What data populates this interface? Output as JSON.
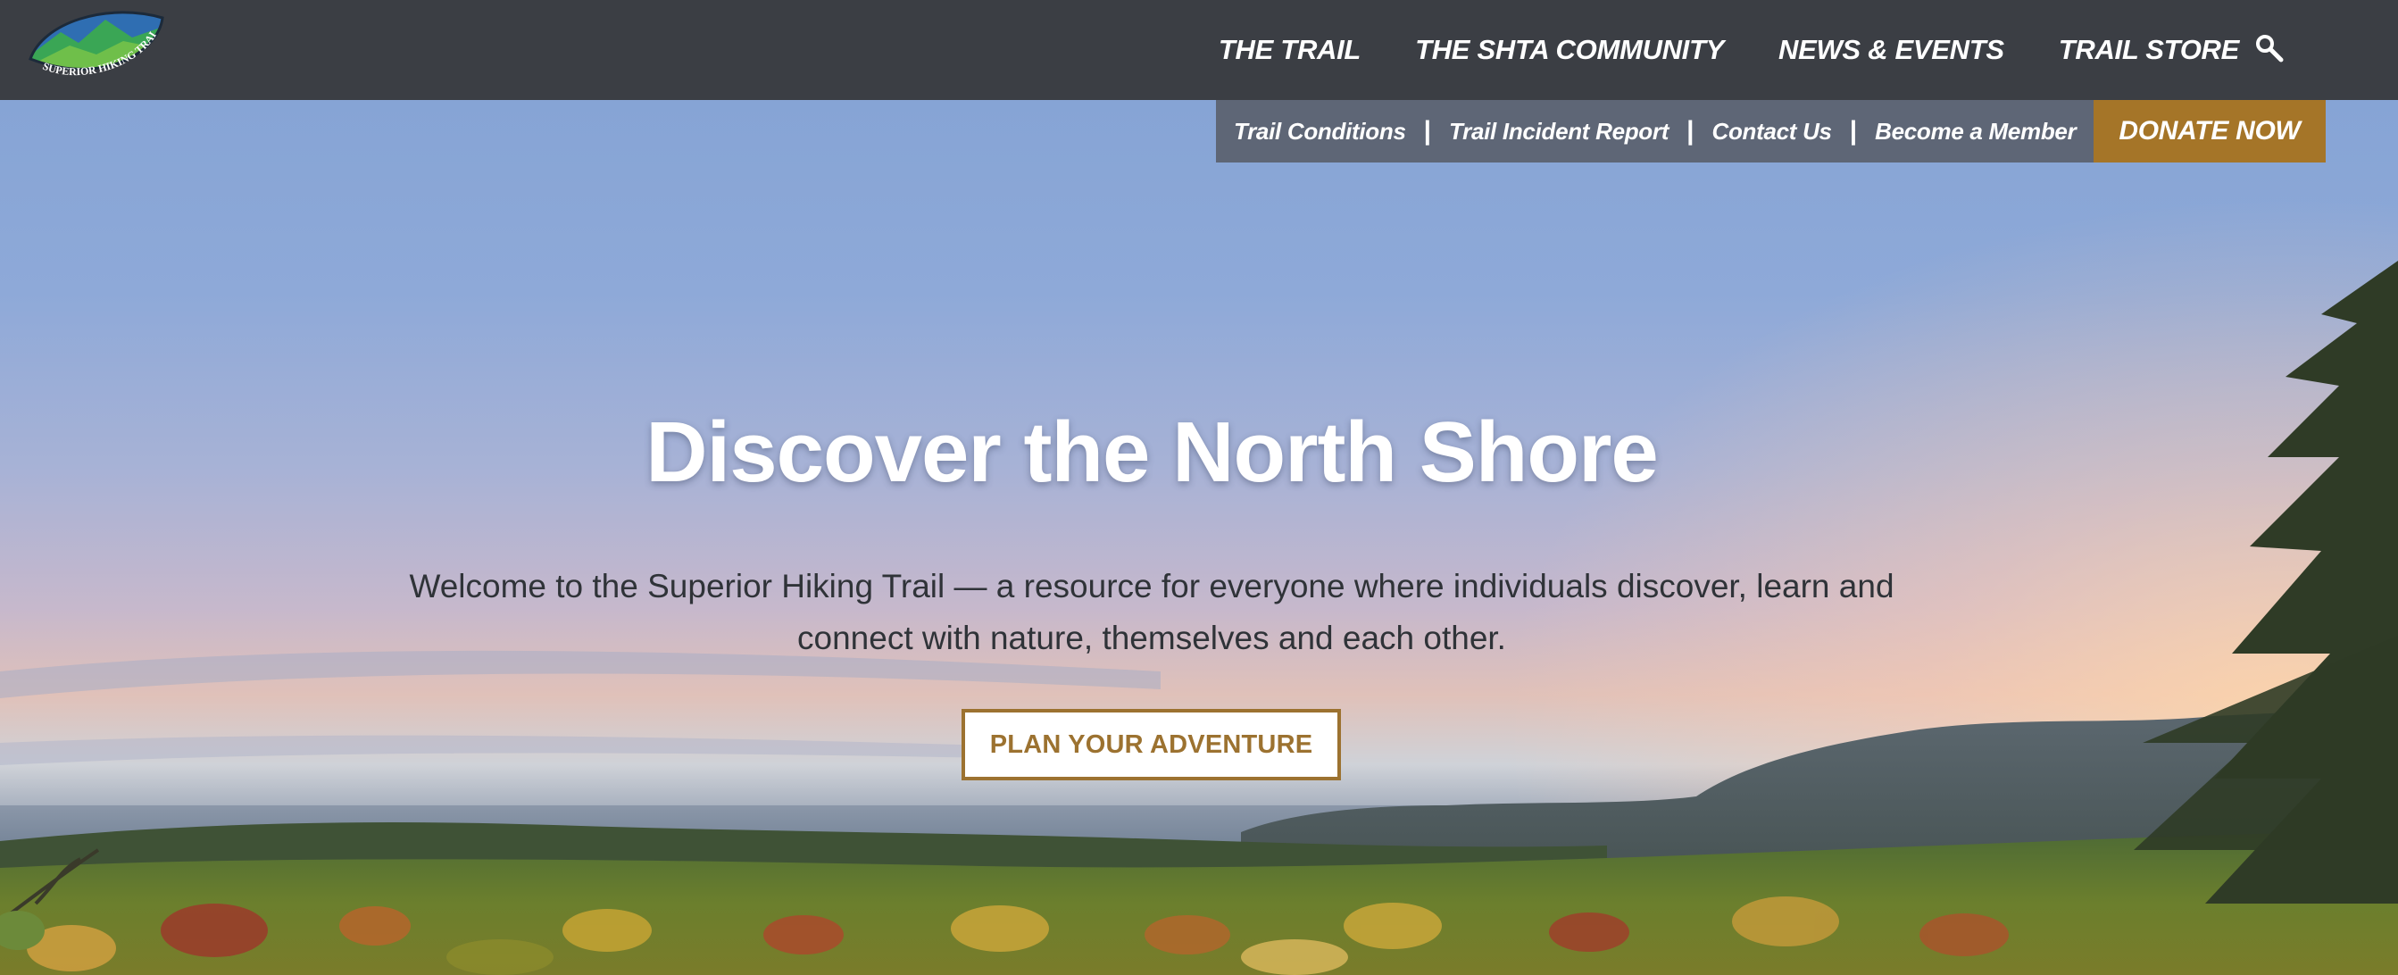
{
  "brand": {
    "logo_text": "SUPERIOR HIKING TRAIL",
    "colors": {
      "nav_bg": "#3b3e44",
      "utility_bg": "#5e6676",
      "accent": "#a57528",
      "cta_border": "#9c7230"
    }
  },
  "main_nav": {
    "items": [
      {
        "label": "THE TRAIL"
      },
      {
        "label": "THE SHTA COMMUNITY"
      },
      {
        "label": "NEWS & EVENTS"
      },
      {
        "label": "TRAIL STORE"
      }
    ],
    "search_icon": "search-icon"
  },
  "utility_nav": {
    "items": [
      {
        "label": "Trail Conditions"
      },
      {
        "label": "Trail Incident Report"
      },
      {
        "label": "Contact Us"
      },
      {
        "label": "Become a Member"
      }
    ],
    "separator": "|",
    "donate_label": "DONATE NOW"
  },
  "hero": {
    "title": "Discover the North Shore",
    "subtitle": "Welcome to the Superior Hiking Trail — a resource for everyone where individuals discover, learn and connect with nature, themselves and each other.",
    "cta_label": "PLAN YOUR ADVENTURE"
  }
}
